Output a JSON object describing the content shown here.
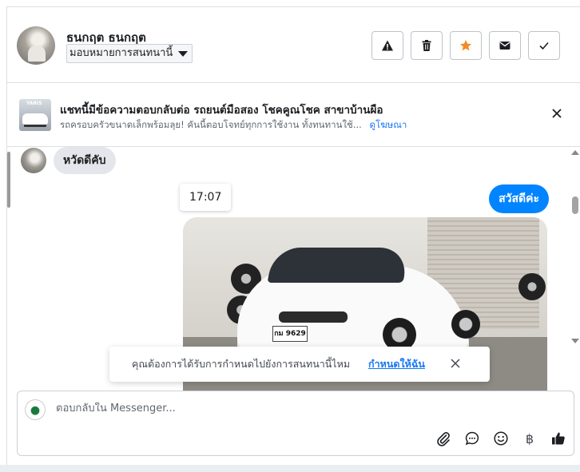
{
  "header": {
    "user_name": "ธนกฤต ธนกฤต",
    "assign_label": "มอบหมายการสนทนานี้"
  },
  "actions": [
    {
      "name": "alert",
      "icon": "warning-icon"
    },
    {
      "name": "delete",
      "icon": "trash-icon"
    },
    {
      "name": "star",
      "icon": "star-icon"
    },
    {
      "name": "mark-unread",
      "icon": "envelope-icon"
    },
    {
      "name": "done",
      "icon": "check-icon"
    }
  ],
  "ad": {
    "title": "แชทนี้มีข้อความตอบกลับต่อ รถยนต์มือสอง โชคคูณโชค สาขาบ้านผือ",
    "subtitle": "รถครอบครัวขนาดเล็กพร้อมลุย! คันนี้ตอบโจทย์ทุกการใช้งาน ทั้งทนทานใช้...",
    "link": "ดูโฆษณา",
    "thumb_label": "YARIS"
  },
  "messages": {
    "incoming_text": "หวัดดีคับ",
    "time": "17:07",
    "outgoing_text": "สวัสดีค่ะ",
    "photo_plate": "กม 9629"
  },
  "toast": {
    "text": "คุณต้องการได้รับการกำหนดไปยังการสนทนานี้ไหม",
    "link": "กำหนดให้ฉัน"
  },
  "composer": {
    "placeholder": "ตอบกลับใน Messenger...",
    "currency_symbol": "฿"
  },
  "colors": {
    "accent": "#0084ff",
    "star": "#f28c28",
    "link": "#1877f2"
  }
}
